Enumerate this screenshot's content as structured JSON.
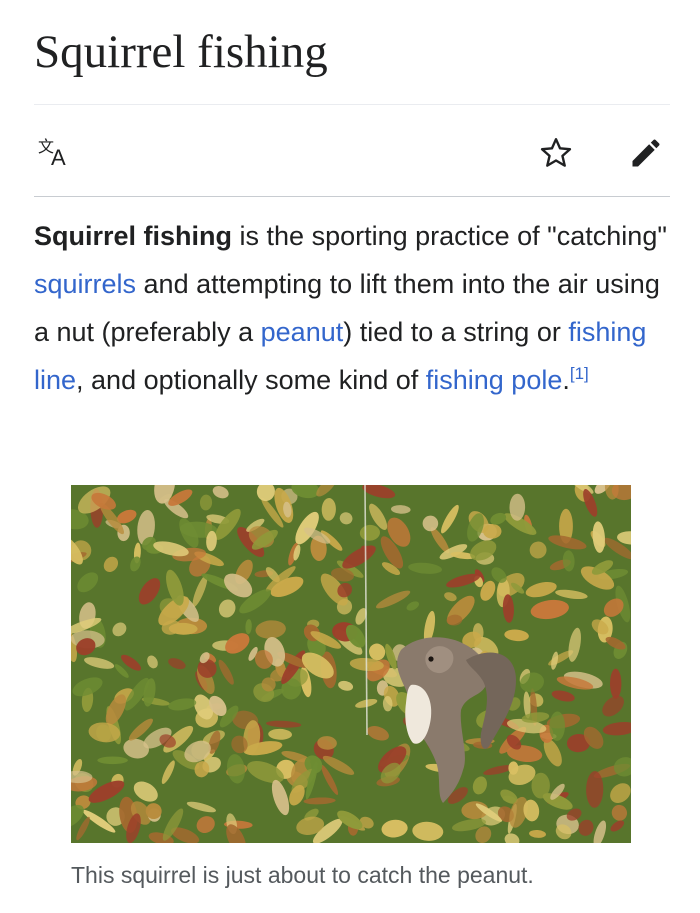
{
  "article": {
    "title": "Squirrel fishing",
    "lead": {
      "bold_term": "Squirrel fishing",
      "text_1": " is the sporting practice of \"catching\" ",
      "link_squirrels": "squirrels",
      "text_2": " and attempting to lift them into the air using a nut (preferably a ",
      "link_peanut": "peanut",
      "text_3": ") tied to a string or ",
      "link_fishing_line": "fishing line",
      "text_4": ", and optionally some kind of ",
      "link_fishing_pole": "fishing pole",
      "text_5": ".",
      "citation": "[1]"
    },
    "figure": {
      "caption": "This squirrel is just about to catch the peanut."
    }
  },
  "toolbar": {
    "icons": [
      "language-icon",
      "star-icon",
      "edit-pencil-icon"
    ]
  },
  "colors": {
    "link": "#3366cc",
    "text": "#202122",
    "caption": "#54595d",
    "divider": "#c8ccd1"
  }
}
